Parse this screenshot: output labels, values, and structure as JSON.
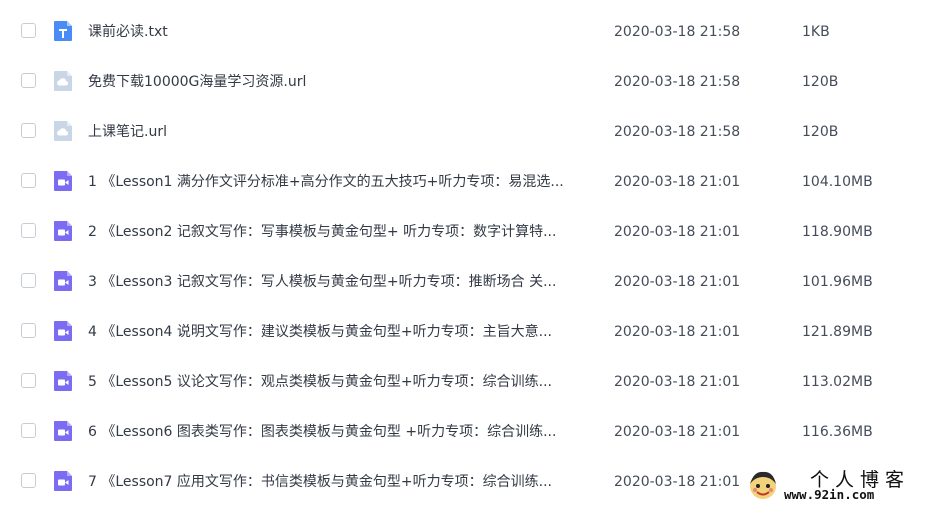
{
  "files": [
    {
      "icon": "text-file-icon",
      "name": "课前必读.txt",
      "date": "2020-03-18 21:58",
      "size": "1KB"
    },
    {
      "icon": "link-file-icon",
      "name": "免费下载10000G海量学习资源.url",
      "date": "2020-03-18 21:58",
      "size": "120B"
    },
    {
      "icon": "link-file-icon",
      "name": "上课笔记.url",
      "date": "2020-03-18 21:58",
      "size": "120B"
    },
    {
      "icon": "video-file-icon",
      "name": "1 《Lesson1 满分作文评分标准+高分作文的五大技巧+听力专项：易混选...",
      "date": "2020-03-18 21:01",
      "size": "104.10MB"
    },
    {
      "icon": "video-file-icon",
      "name": "2 《Lesson2 记叙文写作：写事模板与黄金句型+ 听力专项：数字计算特...",
      "date": "2020-03-18 21:01",
      "size": "118.90MB"
    },
    {
      "icon": "video-file-icon",
      "name": "3 《Lesson3 记叙文写作：写人模板与黄金句型+听力专项：推断场合 关...",
      "date": "2020-03-18 21:01",
      "size": "101.96MB"
    },
    {
      "icon": "video-file-icon",
      "name": "4 《Lesson4 说明文写作：建议类模板与黄金句型+听力专项：主旨大意...",
      "date": "2020-03-18 21:01",
      "size": "121.89MB"
    },
    {
      "icon": "video-file-icon",
      "name": "5 《Lesson5 议论文写作：观点类模板与黄金句型+听力专项：综合训练...",
      "date": "2020-03-18 21:01",
      "size": "113.02MB"
    },
    {
      "icon": "video-file-icon",
      "name": "6 《Lesson6 图表类写作：图表类模板与黄金句型 +听力专项：综合训练...",
      "date": "2020-03-18 21:01",
      "size": "116.36MB"
    },
    {
      "icon": "video-file-icon",
      "name": "7 《Lesson7 应用文写作：书信类模板与黄金句型+听力专项：综合训练...",
      "date": "2020-03-18 21:01",
      "size": ""
    }
  ],
  "colors": {
    "text_file": "#4a8cf6",
    "link_file": "#c9d6e6",
    "video_file": "#7b6cf2",
    "checkbox_border": "#c8ccd4"
  },
  "watermark": {
    "title": "个人博客",
    "url": "www.92in.com"
  }
}
